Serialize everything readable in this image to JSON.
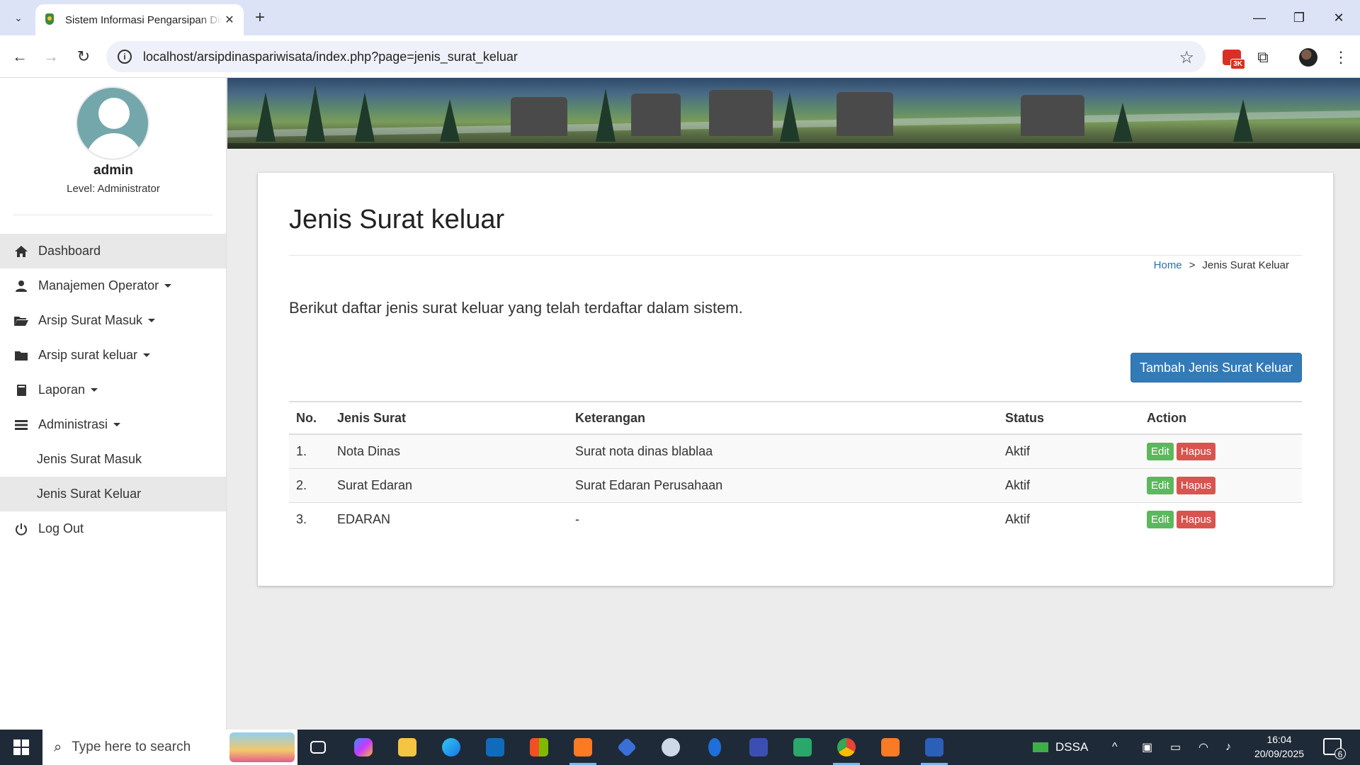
{
  "browser": {
    "tab_title": "Sistem Informasi Pengarsipan Dinas Pariwisata",
    "url": "localhost/arsipdinaspariwisata/index.php?page=jenis_surat_keluar",
    "rec_badge": "3K"
  },
  "sidebar": {
    "user_name": "admin",
    "user_level": "Level: Administrator",
    "menu": {
      "dashboard": "Dashboard",
      "operator": "Manajemen Operator",
      "surat_masuk": "Arsip Surat Masuk",
      "surat_keluar": "Arsip surat keluar",
      "laporan": "Laporan",
      "administrasi": "Administrasi",
      "jenis_masuk": "Jenis Surat Masuk",
      "jenis_keluar": "Jenis Surat Keluar",
      "logout": "Log Out"
    }
  },
  "main": {
    "title": "Jenis Surat keluar",
    "breadcrumb": {
      "home": "Home",
      "separator": ">",
      "current": "Jenis Surat Keluar"
    },
    "intro": "Berikut daftar jenis surat keluar yang telah terdaftar dalam sistem.",
    "add_button": "Tambah Jenis Surat Keluar",
    "table": {
      "headers": {
        "no": "No.",
        "jenis": "Jenis Surat",
        "keterangan": "Keterangan",
        "status": "Status",
        "action": "Action"
      },
      "rows": [
        {
          "no": "1.",
          "jenis": "Nota Dinas",
          "keterangan": "Surat nota dinas blablaa",
          "status": "Aktif",
          "edit": "Edit",
          "hapus": "Hapus"
        },
        {
          "no": "2.",
          "jenis": "Surat Edaran",
          "keterangan": "Surat Edaran Perusahaan",
          "status": "Aktif",
          "edit": "Edit",
          "hapus": "Hapus"
        },
        {
          "no": "3.",
          "jenis": "EDARAN",
          "keterangan": "-",
          "status": "Aktif",
          "edit": "Edit",
          "hapus": "Hapus"
        }
      ]
    }
  },
  "taskbar": {
    "search_placeholder": "Type here to search",
    "tray_label": "DSSA",
    "time": "16:04",
    "date": "20/09/2025",
    "notification_count": "6"
  },
  "colors": {
    "primary": "#337ab7",
    "success": "#5cb85c",
    "danger": "#d9534f",
    "link": "#2a6fb5"
  }
}
